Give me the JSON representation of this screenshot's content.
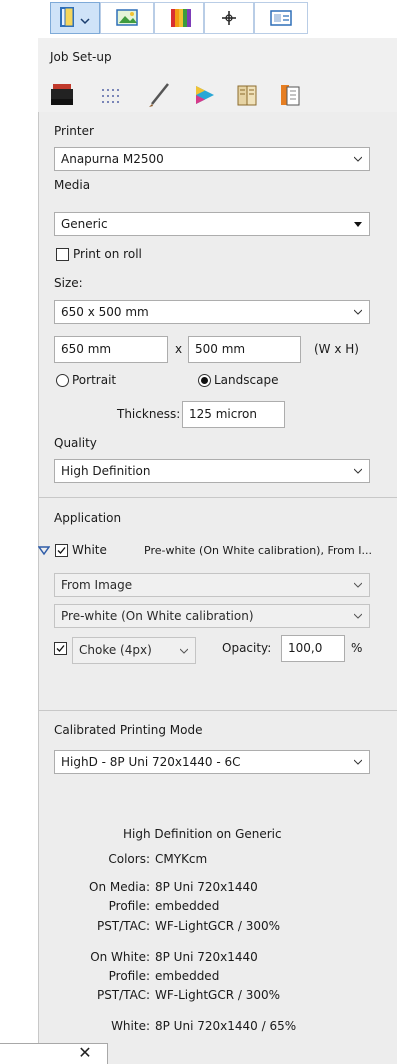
{
  "panel_title": "Job Set-up",
  "top_tabs": [
    "job-setup-tab",
    "layout-tab",
    "color-tab",
    "crosshair-tab",
    "view-tab"
  ],
  "sub_tabs": [
    "printer-tab",
    "grid-tab",
    "brush-tab",
    "color-wheel-tab",
    "book-tab",
    "pages-tab"
  ],
  "printer": {
    "label": "Printer",
    "value": "Anapurna M2500"
  },
  "media": {
    "label": "Media",
    "value": "Generic",
    "print_on_roll": "Print on roll"
  },
  "size": {
    "label": "Size:",
    "value": "650 x 500 mm",
    "width": "650 mm",
    "times": "x",
    "height": "500 mm",
    "wxh": "(W x H)",
    "portrait": "Portrait",
    "landscape": "Landscape",
    "thickness_label": "Thickness:",
    "thickness": "125 micron"
  },
  "quality": {
    "label": "Quality",
    "value": "High Definition"
  },
  "application": {
    "label": "Application",
    "white_label": "White",
    "white_summary": "Pre-white (On White calibration), From I...",
    "source": "From Image",
    "mode": "Pre-white (On White calibration)",
    "choke": "Choke (4px)",
    "opacity_label": "Opacity:",
    "opacity": "100,0",
    "percent": "%"
  },
  "calibrated": {
    "label": "Calibrated Printing Mode",
    "value": "HighD - 8P Uni 720x1440 - 6C"
  },
  "summary": {
    "title": "High Definition on Generic",
    "colors_label": "Colors:",
    "colors": "CMYKcm",
    "on_media_label": "On Media:",
    "on_media": "8P Uni 720x1440",
    "profile_label": "Profile:",
    "profile": "embedded",
    "psttac_label": "PST/TAC:",
    "psttac": "WF-LightGCR / 300%",
    "on_white_label": "On White:",
    "on_white": "8P Uni 720x1440",
    "profile2_label": "Profile:",
    "profile2": "embedded",
    "psttac2_label": "PST/TAC:",
    "psttac2": "WF-LightGCR / 300%",
    "white_label": "White:",
    "white": "8P Uni 720x1440 / 65%"
  },
  "close_glyph": "✕"
}
